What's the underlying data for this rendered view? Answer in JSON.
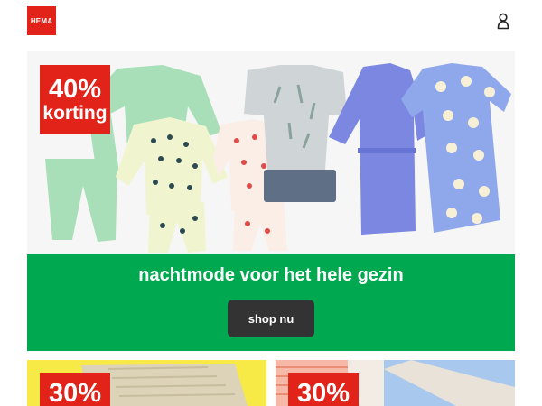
{
  "header": {
    "logo_text": "HEMA",
    "brand_color": "#e1231a",
    "account_icon": "account-icon"
  },
  "hero": {
    "badge_percent": "40%",
    "badge_word": "korting",
    "title": "nachtmode voor het hele gezin",
    "cta_label": "shop nu",
    "band_color": "#00a94f",
    "cta_color": "#333333"
  },
  "tiles": [
    {
      "badge_percent": "30%",
      "background": "#f7e946"
    },
    {
      "badge_percent": "30%",
      "background": "#f2ece4"
    }
  ]
}
